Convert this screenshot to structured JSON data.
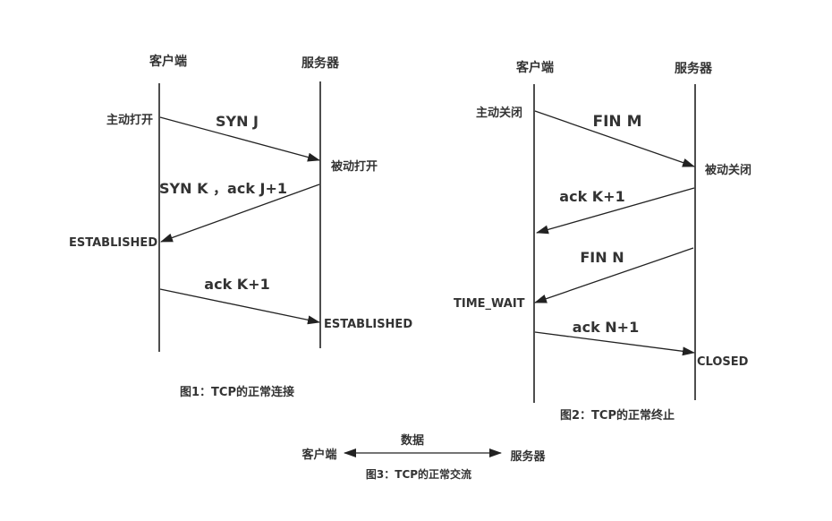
{
  "figure1": {
    "client": "客户端",
    "server": "服务器",
    "client_open": "主动打开",
    "server_open": "被动打开",
    "msg1": "SYN J",
    "msg2": "SYN K ，ack  J+1",
    "msg3": "ack K+1",
    "client_state": "ESTABLISHED",
    "server_state": "ESTABLISHED",
    "caption": "图1：TCP的正常连接"
  },
  "figure2": {
    "client": "客户端",
    "server": "服务器",
    "client_close": "主动关闭",
    "server_close": "被动关闭",
    "msg1": "FIN  M",
    "msg2": "ack  K+1",
    "msg3": "FIN N",
    "msg4": "ack N+1",
    "client_state": "TIME_WAIT",
    "server_state": "CLOSED",
    "caption": "图2：TCP的正常终止"
  },
  "figure3": {
    "client": "客户端",
    "server": "服务器",
    "data_label": "数据",
    "caption": "图3：TCP的正常交流"
  }
}
